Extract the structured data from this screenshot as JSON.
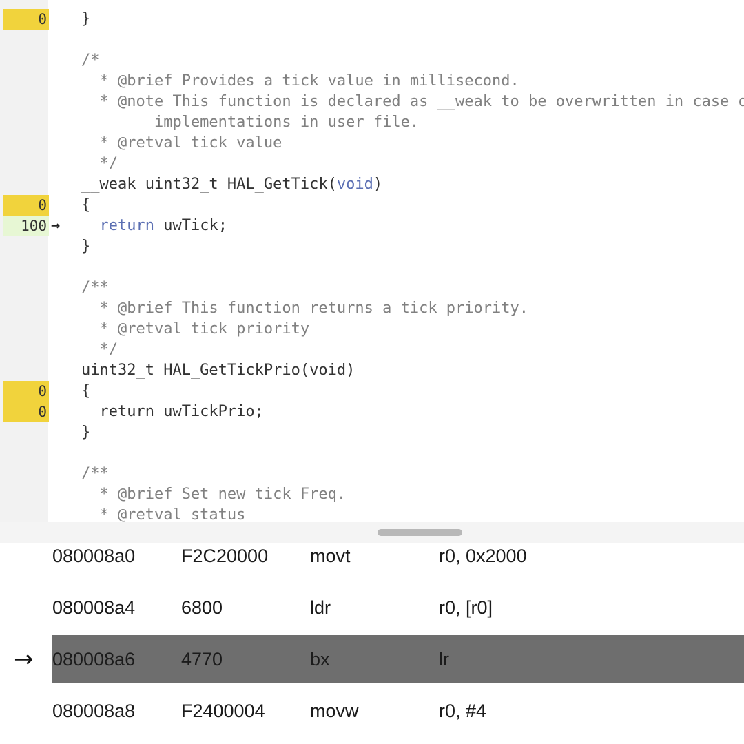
{
  "source": {
    "lines": [
      {
        "count": "0",
        "code": "}",
        "style": "code"
      },
      {
        "count": "",
        "code": "",
        "style": "code"
      },
      {
        "count": "",
        "code": "/*",
        "style": "comment"
      },
      {
        "count": "",
        "code": "  * @brief Provides a tick value in millisecond.",
        "style": "comment"
      },
      {
        "count": "",
        "code": "  * @note This function is declared as __weak to be overwritten in case of other",
        "style": "comment"
      },
      {
        "count": "",
        "code": "        implementations in user file.",
        "style": "comment"
      },
      {
        "count": "",
        "code": "  * @retval tick value",
        "style": "comment"
      },
      {
        "count": "",
        "code": "  */",
        "style": "comment"
      },
      {
        "count": "",
        "code": "__weak uint32_t HAL_GetTick(void)",
        "style": "code",
        "keyword": "void"
      },
      {
        "count": "0",
        "code": "{",
        "style": "code"
      },
      {
        "count": "100",
        "code": "  return uwTick;",
        "style": "code",
        "keyword": "return",
        "current": true
      },
      {
        "count": "",
        "code": "}",
        "style": "code"
      },
      {
        "count": "",
        "code": "",
        "style": "code"
      },
      {
        "count": "",
        "code": "/**",
        "style": "comment"
      },
      {
        "count": "",
        "code": "  * @brief This function returns a tick priority.",
        "style": "comment"
      },
      {
        "count": "",
        "code": "  * @retval tick priority",
        "style": "comment"
      },
      {
        "count": "",
        "code": "  */",
        "style": "comment"
      },
      {
        "count": "",
        "code": "uint32_t HAL_GetTickPrio(void)",
        "style": "code"
      },
      {
        "count": "0",
        "code": "{",
        "style": "code"
      },
      {
        "count": "0",
        "code": "  return uwTickPrio;",
        "style": "code"
      },
      {
        "count": "",
        "code": "}",
        "style": "code"
      },
      {
        "count": "",
        "code": "",
        "style": "code"
      },
      {
        "count": "",
        "code": "/**",
        "style": "comment"
      },
      {
        "count": "",
        "code": "  * @brief Set new tick Freq.",
        "style": "comment"
      },
      {
        "count": "",
        "code": "  * @retval status",
        "style": "comment"
      }
    ],
    "exec_arrow": "→"
  },
  "disassembly": {
    "current_arrow": "→",
    "rows": [
      {
        "address": "080008a0",
        "opcode": "F2C20000",
        "mnemonic": "movt",
        "operands": "r0, 0x2000"
      },
      {
        "address": "080008a4",
        "opcode": "6800",
        "mnemonic": "ldr",
        "operands": "r0, [r0]"
      },
      {
        "address": "080008a6",
        "opcode": "4770",
        "mnemonic": "bx",
        "operands": "lr",
        "current": true
      },
      {
        "address": "080008a8",
        "opcode": "F2400004",
        "mnemonic": "movw",
        "operands": "r0, #4"
      }
    ]
  }
}
